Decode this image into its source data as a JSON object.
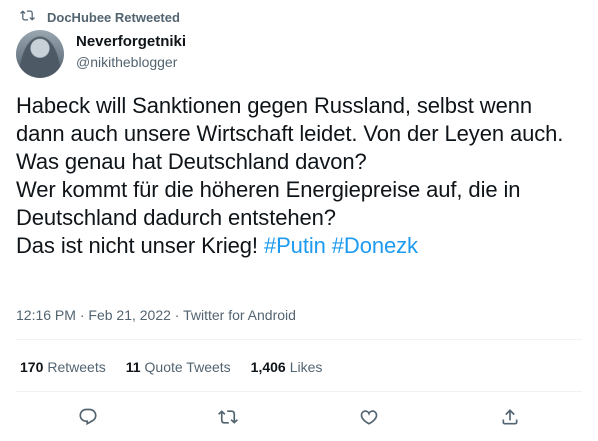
{
  "retweet": {
    "label": "DocHubee Retweeted"
  },
  "author": {
    "display_name": "Neverforgetniki",
    "handle": "@nikitheblogger"
  },
  "tweet": {
    "text": "Habeck will Sanktionen gegen Russland, selbst wenn dann auch unsere Wirtschaft leidet. Von der Leyen auch.\nWas genau hat Deutschland davon?\nWer kommt für die höheren Energiepreise auf, die in Deutschland dadurch entstehen?\nDas ist nicht unser Krieg! ",
    "hashtags": [
      "#Putin",
      "#Donezk"
    ]
  },
  "meta": {
    "time": "12:16 PM",
    "date": "Feb 21, 2022",
    "source": "Twitter for Android",
    "separator": "·"
  },
  "stats": {
    "retweets_count": "170",
    "retweets_label": "Retweets",
    "quotes_count": "11",
    "quotes_label": "Quote Tweets",
    "likes_count": "1,406",
    "likes_label": "Likes"
  },
  "icons": {
    "retweet": "retweet-icon",
    "reply": "reply-icon",
    "like": "heart-icon",
    "share": "share-icon"
  },
  "colors": {
    "accent": "#1d9bf0",
    "secondary_text": "#536471",
    "text": "#0f1419"
  }
}
